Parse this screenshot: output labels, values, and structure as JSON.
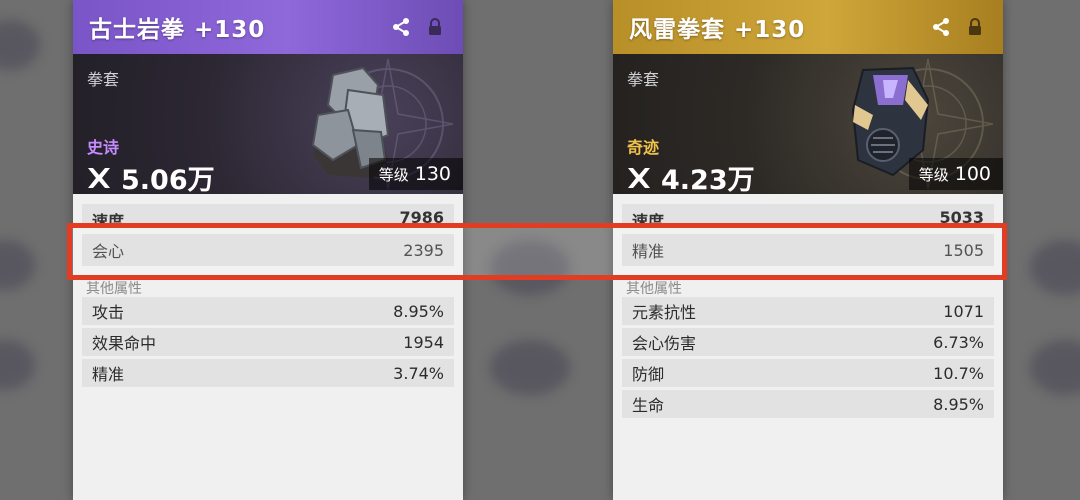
{
  "cards": [
    {
      "name": "古士岩拳 +130",
      "category": "拳套",
      "rarity": "史诗",
      "power": "5.06万",
      "level_label": "等级",
      "level": "130",
      "main_stats": [
        {
          "label": "速度",
          "value": "7986"
        },
        {
          "label": "会心",
          "value": "2395"
        }
      ],
      "other_title": "其他属性",
      "other_stats": [
        {
          "label": "攻击",
          "value": "8.95%"
        },
        {
          "label": "效果命中",
          "value": "1954"
        },
        {
          "label": "精准",
          "value": "3.74%"
        }
      ],
      "colors": {
        "header": "#8f68da",
        "rarity": "#c68cff"
      }
    },
    {
      "name": "风雷拳套 +130",
      "category": "拳套",
      "rarity": "奇迹",
      "power": "4.23万",
      "level_label": "等级",
      "level": "100",
      "main_stats": [
        {
          "label": "速度",
          "value": "5033"
        },
        {
          "label": "精准",
          "value": "1505"
        }
      ],
      "other_title": "其他属性",
      "other_stats": [
        {
          "label": "元素抗性",
          "value": "1071"
        },
        {
          "label": "会心伤害",
          "value": "6.73%"
        },
        {
          "label": "防御",
          "value": "10.7%"
        },
        {
          "label": "生命",
          "value": "8.95%"
        }
      ],
      "colors": {
        "header": "#cfa63a",
        "rarity": "#f0c24a"
      }
    }
  ],
  "icons": [
    "share-icon",
    "lock-icon",
    "power-icon"
  ],
  "highlight_color": "#e23d22"
}
